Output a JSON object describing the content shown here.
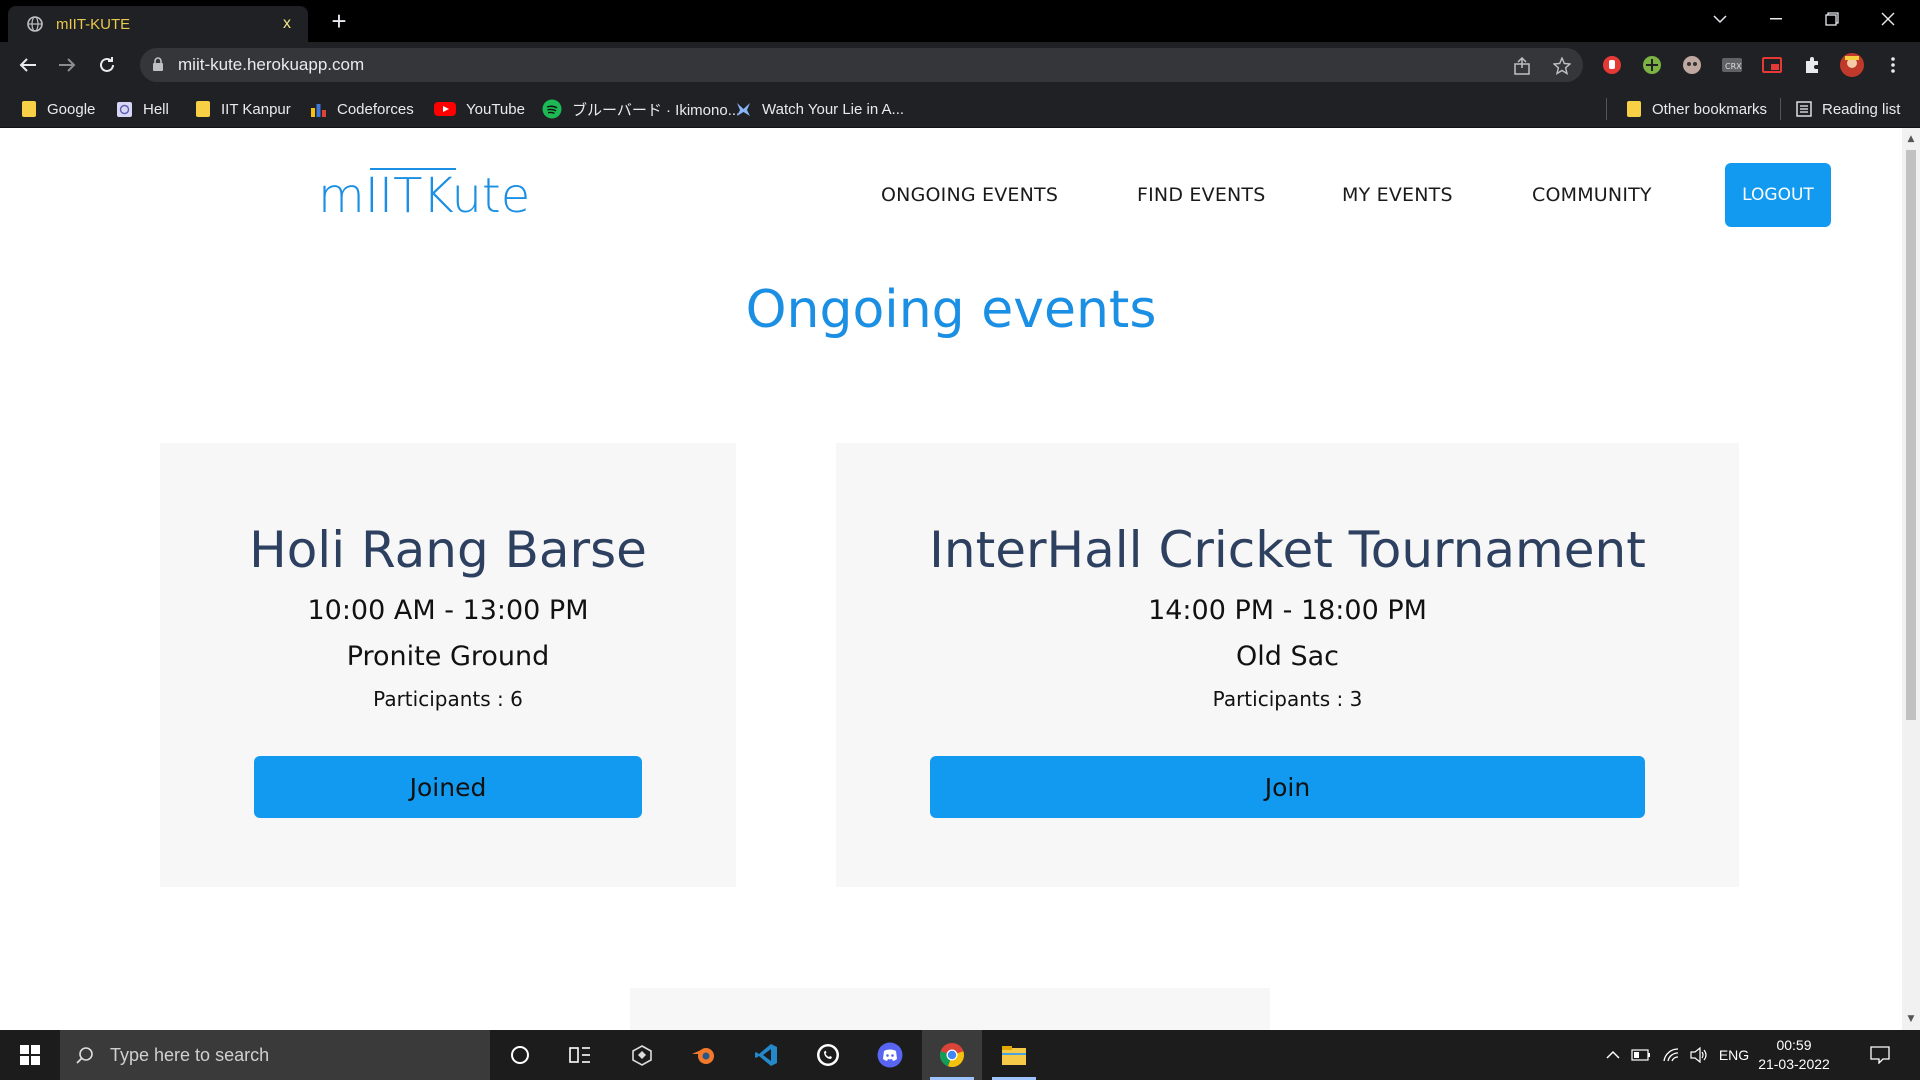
{
  "browser": {
    "tab_title": "mIIT-KUTE",
    "tab_close": "x",
    "new_tab": "+",
    "url": "miit-kute.herokuapp.com"
  },
  "bookmarks": {
    "items": [
      {
        "label": "Google"
      },
      {
        "label": "Hell"
      },
      {
        "label": "IIT Kanpur"
      },
      {
        "label": "Codeforces"
      },
      {
        "label": "YouTube"
      },
      {
        "label": "ブルーバード · Ikimono..."
      },
      {
        "label": "Watch Your Lie in A..."
      }
    ],
    "other": "Other bookmarks",
    "reading_list": "Reading list"
  },
  "site": {
    "logo": "mIITKute",
    "nav": {
      "ongoing": "ONGOING EVENTS",
      "find": "FIND EVENTS",
      "my": "MY EVENTS",
      "community": "COMMUNITY",
      "logout": "LOGOUT"
    },
    "page_title": "Ongoing events",
    "events": [
      {
        "name": "Holi Rang Barse",
        "time": "10:00 AM - 13:00 PM",
        "place": "Pronite Ground",
        "participants": "Participants : 6",
        "button": "Joined"
      },
      {
        "name": "InterHall Cricket Tournament",
        "time": "14:00 PM - 18:00 PM",
        "place": "Old Sac",
        "participants": "Participants : 3",
        "button": "Join"
      }
    ]
  },
  "taskbar": {
    "search_placeholder": "Type here to search",
    "language": "ENG",
    "time": "00:59",
    "date": "21-03-2022"
  },
  "colors": {
    "brand_blue": "#1a8fe3",
    "button_blue": "#129af0",
    "card_bg": "#f7f7f7",
    "event_title": "#2e4060"
  }
}
